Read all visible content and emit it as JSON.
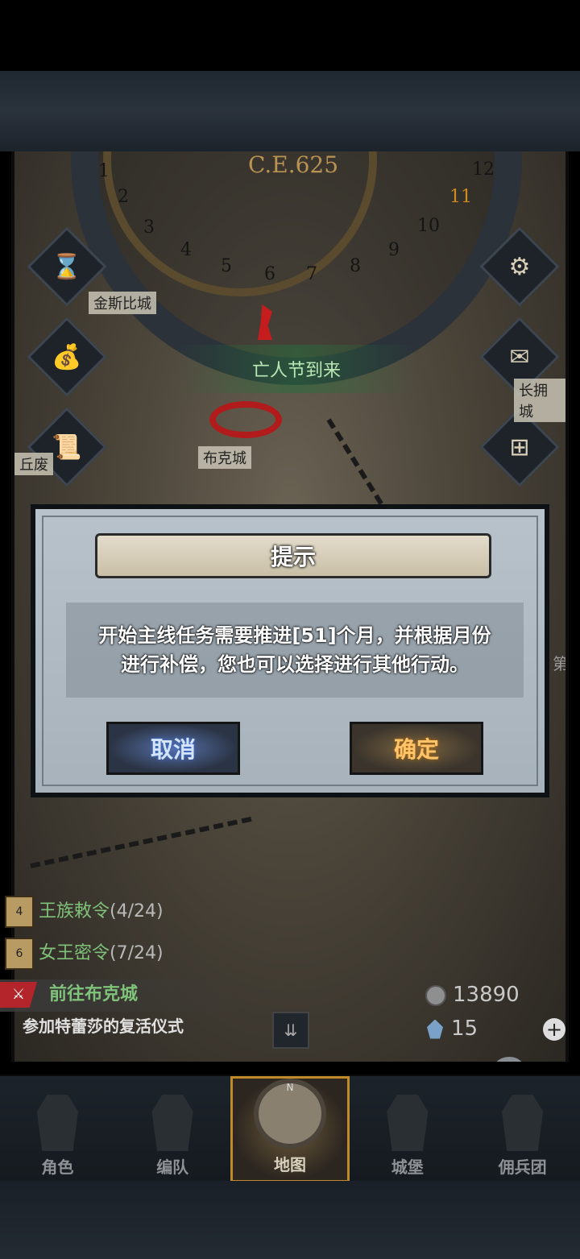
{
  "map": {
    "year": "C.E.625",
    "months": [
      "1",
      "2",
      "3",
      "4",
      "5",
      "6",
      "7",
      "8",
      "9",
      "10",
      "11",
      "12"
    ],
    "locations": {
      "jinsibi": "金斯比城",
      "buke": "布克城",
      "zhangyong": "长拥城",
      "qiufei": "丘废"
    },
    "event_banner": "亡人节到来",
    "edge_text": "第"
  },
  "quests": {
    "royal_decree": {
      "label": "王族敕令",
      "progress": "(4/24)",
      "badge": "4"
    },
    "queen_secret": {
      "label": "女王密令",
      "progress": "(7/24)",
      "badge": "6"
    },
    "main_title": "前往布克城",
    "main_desc": "参加特蕾莎的复活仪式"
  },
  "resources": {
    "silver": "13890",
    "gems": "15"
  },
  "dialog": {
    "title": "提示",
    "message_line1": "开始主线任务需要推进[51]个月，并根据月份",
    "message_line2": "进行补偿，您也可以选择进行其他行动。",
    "cancel": "取消",
    "confirm": "确定"
  },
  "nav": {
    "items": [
      "角色",
      "编队",
      "地图",
      "城堡",
      "佣兵团"
    ],
    "active": "地图",
    "compass_letter": "N"
  },
  "colors": {
    "cancel_text": "#d4e4ff",
    "confirm_text": "#ffc46a",
    "quest_green": "#7fc27a",
    "event_green": "#b9e8b4"
  }
}
